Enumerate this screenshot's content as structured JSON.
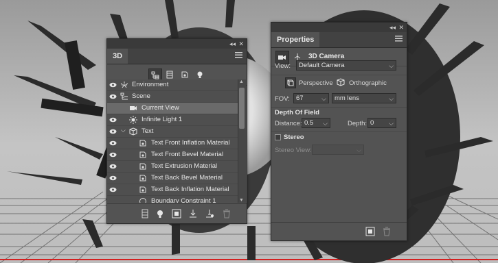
{
  "panel_3d": {
    "tab_label": "3D",
    "toolbar": [
      {
        "icon": "scene-filter-icon",
        "active": true
      },
      {
        "icon": "mesh-filter-icon",
        "active": false
      },
      {
        "icon": "material-filter-icon",
        "active": false
      },
      {
        "icon": "light-filter-icon",
        "active": false
      }
    ],
    "rows": [
      {
        "label": "Environment",
        "icon": "environment-icon",
        "indent": 0
      },
      {
        "label": "Scene",
        "icon": "scene-icon",
        "indent": 0
      },
      {
        "label": "Current View",
        "icon": "camera-icon",
        "indent": 1,
        "selected": true
      },
      {
        "label": "Infinite Light 1",
        "icon": "light-icon",
        "indent": 1
      },
      {
        "label": "Text",
        "icon": "mesh-icon",
        "indent": 1,
        "expanded": true
      },
      {
        "label": "Text Front Inflation Material",
        "icon": "material-icon",
        "indent": 2
      },
      {
        "label": "Text Front Bevel Material",
        "icon": "material-icon",
        "indent": 2
      },
      {
        "label": "Text Extrusion Material",
        "icon": "material-icon",
        "indent": 2
      },
      {
        "label": "Text Back Bevel Material",
        "icon": "material-icon",
        "indent": 2
      },
      {
        "label": "Text Back Inflation Material",
        "icon": "material-icon",
        "indent": 2
      },
      {
        "label": "Boundary Constraint 1",
        "icon": "constraint-icon",
        "indent": 2
      }
    ],
    "bottom_icons": [
      "new-mesh-icon",
      "add-light-icon",
      "render-icon",
      "export-icon",
      "constraint-add-icon",
      "trash-icon"
    ]
  },
  "properties": {
    "tab_label": "Properties",
    "header_title": "3D Camera",
    "view_label": "View:",
    "view_value": "Default Camera",
    "perspective_label": "Perspective",
    "orthographic_label": "Orthographic",
    "fov_label": "FOV:",
    "fov_value": "67",
    "lens_value": "mm lens",
    "dof_section": "Depth Of Field",
    "distance_label": "Distance:",
    "distance_value": "0.5",
    "depth_label": "Depth:",
    "depth_value": "0",
    "stereo_label": "Stereo",
    "stereo_view_label": "Stereo View:",
    "stereo_view_value": ""
  },
  "colors": {
    "panel_bg": "#535353",
    "selected_row": "#6a6a6a",
    "floor_line": "#d32020"
  }
}
